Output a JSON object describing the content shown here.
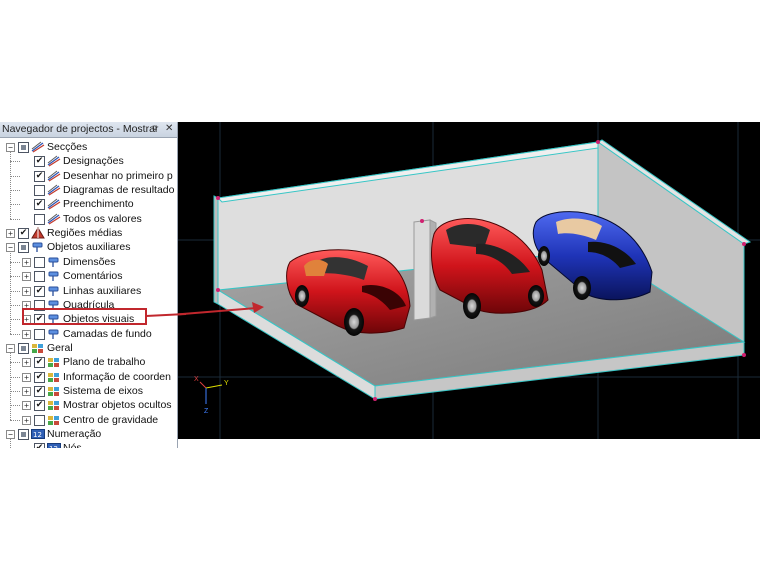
{
  "panel": {
    "title": "Navegador de projectos - Mostrar",
    "pin_glyph": "¤",
    "close_glyph": "✕"
  },
  "tree": [
    {
      "id": "seccoes",
      "label": "Secções",
      "level": 0,
      "expander": "minus",
      "check": "partial",
      "icon": "section-lines-icon"
    },
    {
      "id": "designacoes",
      "label": "Designações",
      "level": 1,
      "expander": "none",
      "check": "checked",
      "icon": "section-lines-icon"
    },
    {
      "id": "desenhar",
      "label": "Desenhar no primeiro p",
      "level": 1,
      "expander": "none",
      "check": "checked",
      "icon": "section-lines-icon"
    },
    {
      "id": "diagramas",
      "label": "Diagramas de resultado",
      "level": 1,
      "expander": "none",
      "check": "unchecked",
      "icon": "section-lines-icon"
    },
    {
      "id": "preenchimento",
      "label": "Preenchimento",
      "level": 1,
      "expander": "none",
      "check": "checked",
      "icon": "section-lines-icon"
    },
    {
      "id": "todos",
      "label": "Todos os valores",
      "level": 1,
      "expander": "none",
      "check": "unchecked",
      "icon": "section-lines-icon"
    },
    {
      "id": "regioes",
      "label": "Regiões médias",
      "level": 0,
      "expander": "plus",
      "check": "checked",
      "icon": "region-icon"
    },
    {
      "id": "objetos-aux",
      "label": "Objetos auxiliares",
      "level": 0,
      "expander": "minus",
      "check": "partial",
      "icon": "pin-icon"
    },
    {
      "id": "dimensoes",
      "label": "Dimensões",
      "level": 1,
      "expander": "plus",
      "check": "unchecked",
      "icon": "pin-icon"
    },
    {
      "id": "comentarios",
      "label": "Comentários",
      "level": 1,
      "expander": "plus",
      "check": "unchecked",
      "icon": "pin-icon"
    },
    {
      "id": "linhas-aux",
      "label": "Linhas auxiliares",
      "level": 1,
      "expander": "plus",
      "check": "checked",
      "icon": "pin-icon"
    },
    {
      "id": "quadricula",
      "label": "Quadrícula",
      "level": 1,
      "expander": "plus",
      "check": "unchecked",
      "icon": "pin-icon"
    },
    {
      "id": "objetos-visuais",
      "label": "Objetos visuais",
      "level": 1,
      "expander": "plus",
      "check": "checked",
      "icon": "pin-icon"
    },
    {
      "id": "camadas",
      "label": "Camadas de fundo",
      "level": 1,
      "expander": "plus",
      "check": "unchecked",
      "icon": "pin-icon"
    },
    {
      "id": "geral",
      "label": "Geral",
      "level": 0,
      "expander": "minus",
      "check": "partial",
      "icon": "general-icon"
    },
    {
      "id": "plano",
      "label": "Plano de trabalho",
      "level": 1,
      "expander": "plus",
      "check": "checked",
      "icon": "general-icon"
    },
    {
      "id": "informacao",
      "label": "Informação de coorden",
      "level": 1,
      "expander": "plus",
      "check": "checked",
      "icon": "general-icon"
    },
    {
      "id": "sistema",
      "label": "Sistema de eixos",
      "level": 1,
      "expander": "plus",
      "check": "checked",
      "icon": "general-icon"
    },
    {
      "id": "mostrar-ocultos",
      "label": "Mostrar objetos ocultos",
      "level": 1,
      "expander": "plus",
      "check": "checked",
      "icon": "general-icon"
    },
    {
      "id": "centro",
      "label": "Centro de gravidade",
      "level": 1,
      "expander": "plus",
      "check": "unchecked",
      "icon": "general-icon"
    },
    {
      "id": "numeracao",
      "label": "Numeração",
      "level": 0,
      "expander": "minus",
      "check": "partial",
      "icon": "numbering-icon"
    },
    {
      "id": "nos",
      "label": "Nós",
      "level": 1,
      "expander": "none",
      "check": "checked",
      "icon": "numbering-icon"
    }
  ],
  "highlighted_item": "objetos-visuais",
  "axes": {
    "x": "X",
    "y": "Y",
    "z": "Z"
  },
  "colors": {
    "viewport_bg": "#000000",
    "highlight": "#c1272d",
    "red_car": "#d0141b",
    "blue_car": "#1f34b8",
    "floor": "#8d8d8d",
    "wall": "#d9d9d9",
    "edge": "#37c6c6"
  }
}
